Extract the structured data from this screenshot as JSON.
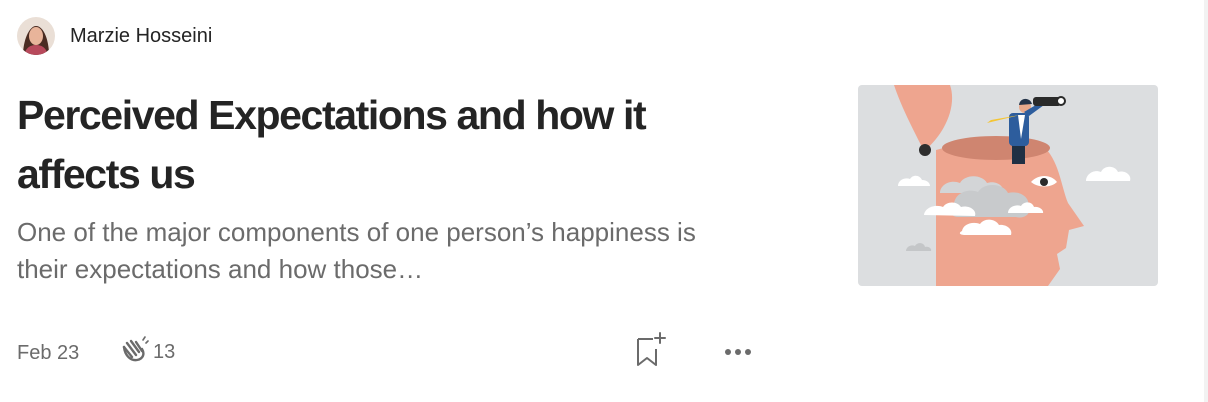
{
  "author": {
    "name": "Marzie Hosseini",
    "avatar_icon": "author-avatar"
  },
  "article": {
    "title": "Perceived Expectations and how it affects us",
    "subtitle": "One of the major components of one person’s happiness is their expectations and how those…",
    "thumbnail_icon": "head-with-binoculars-illustration"
  },
  "meta": {
    "date": "Feb 23",
    "clap_icon": "clap-icon",
    "clap_count": "13",
    "bookmark_icon": "bookmark-add-icon",
    "more_icon": "more-options-icon"
  },
  "colors": {
    "text_primary": "#242424",
    "text_secondary": "#6b6b6b",
    "thumb_bg": "#dcdee0",
    "head_skin": "#eea58f"
  }
}
